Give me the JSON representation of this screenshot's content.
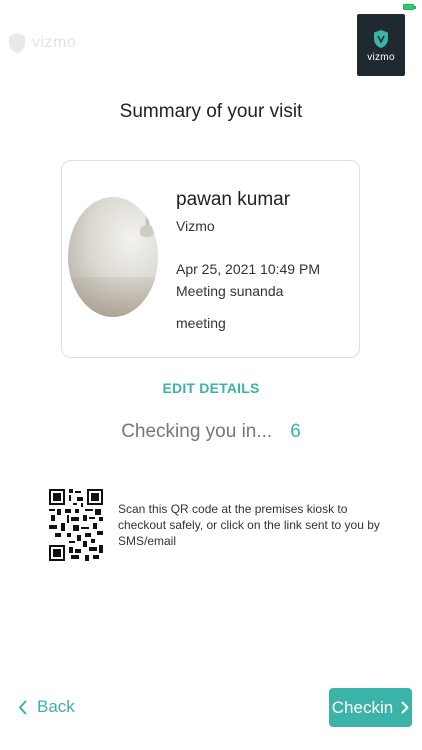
{
  "header": {
    "faint_logo_text": "vizmo",
    "brand_text": "vizmo"
  },
  "page": {
    "title": "Summary of your visit"
  },
  "visitor": {
    "name": "pawan kumar",
    "company": "Vizmo",
    "datetime": "Apr 25, 2021 10:49 PM",
    "host": "Meeting sunanda",
    "purpose": "meeting"
  },
  "actions": {
    "edit_details_label": "EDIT DETAILS",
    "back_label": "Back",
    "checkin_label": "Checkin"
  },
  "status": {
    "checking_text": "Checking you in...",
    "countdown": "6"
  },
  "qr": {
    "instructions": "Scan this QR code at the premises kiosk to checkout safely, or click on the link sent to you by SMS/email"
  },
  "colors": {
    "accent": "#3bb3a8",
    "brand_bg": "#1f2a30"
  },
  "icons": {
    "brand": "vizmo-shield-icon",
    "back": "chevron-left-icon",
    "checkin": "chevron-right-icon",
    "battery": "battery-icon"
  }
}
